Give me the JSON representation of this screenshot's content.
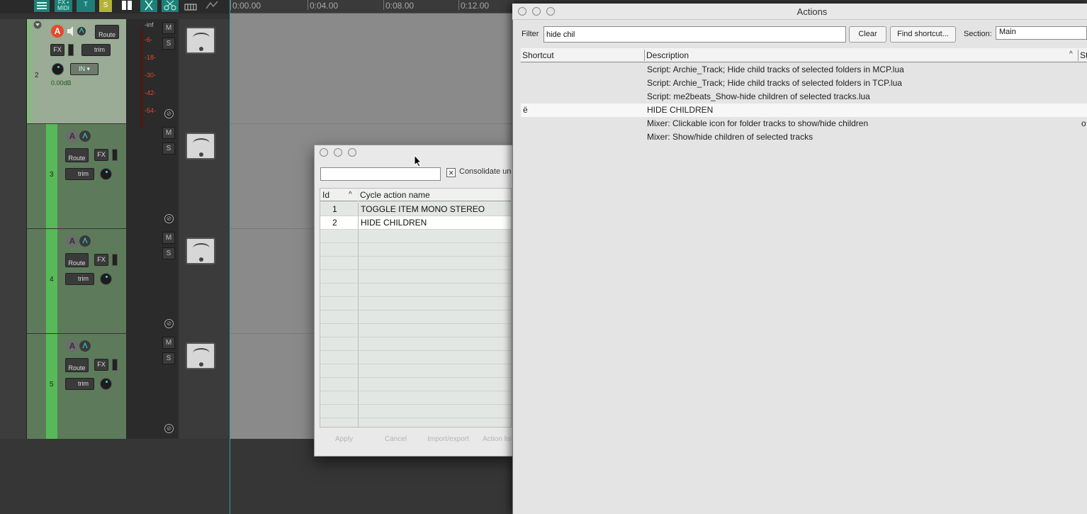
{
  "toolbar": {
    "buttons": [
      {
        "label": "",
        "icon": "grid-icon"
      },
      {
        "label": "FX • MIDI",
        "icon": ""
      },
      {
        "label": "T",
        "icon": ""
      },
      {
        "label": "S",
        "icon": ""
      },
      {
        "label": "",
        "icon": "split-icon"
      },
      {
        "label": "",
        "icon": "cut-icon"
      },
      {
        "label": "",
        "icon": "scissors-icon"
      },
      {
        "label": "",
        "icon": "snap-icon"
      },
      {
        "label": "",
        "icon": "envelope-icon"
      }
    ]
  },
  "ruler": {
    "ticks": [
      "0:00.00",
      "0:04.00",
      "0:08.00",
      "0:12.00"
    ]
  },
  "tracks": [
    {
      "number": "2",
      "volume": "0.00dB",
      "route": "Route",
      "fx": "FX",
      "trim": "trim",
      "input": "IN",
      "mute": "M",
      "solo": "S",
      "phase": "⊘",
      "folder": true
    },
    {
      "number": "3",
      "route": "Route",
      "fx": "FX",
      "trim": "trim",
      "mute": "M",
      "solo": "S",
      "phase": "⊘"
    },
    {
      "number": "4",
      "route": "Route",
      "fx": "FX",
      "trim": "trim",
      "mute": "M",
      "solo": "S",
      "phase": "⊘"
    },
    {
      "number": "5",
      "route": "Route",
      "fx": "FX",
      "trim": "trim",
      "mute": "M",
      "solo": "S",
      "phase": "⊘"
    }
  ],
  "meter": {
    "labels": [
      "-inf",
      "-6-",
      "-18-",
      "-30-",
      "-42-",
      "-54-"
    ]
  },
  "cycle_dialog": {
    "search_value": "",
    "consolidate_label": "Consolidate undo",
    "consolidate_checked": true,
    "columns": {
      "id": "Id",
      "name": "Cycle action name"
    },
    "rows": [
      {
        "id": "1",
        "name": "TOGGLE ITEM MONO STEREO"
      },
      {
        "id": "2",
        "name": "HIDE CHILDREN"
      }
    ],
    "buttons": {
      "apply": "Apply",
      "cancel": "Cancel",
      "import_export": "Import/export",
      "action_list": "Action list"
    }
  },
  "actions_window": {
    "title": "Actions",
    "filter_label": "Filter",
    "filter_value": "hide chil",
    "clear_label": "Clear",
    "find_shortcut_label": "Find shortcut...",
    "section_label": "Section:",
    "section_value": "Main",
    "columns": {
      "shortcut": "Shortcut",
      "description": "Description",
      "state": "St"
    },
    "rows": [
      {
        "shortcut": "",
        "description": "Script: Archie_Track;  Hide child tracks of selected folders in MCP.lua",
        "extra": ""
      },
      {
        "shortcut": "",
        "description": "Script: Archie_Track;  Hide child tracks of selected folders in TCP.lua",
        "extra": ""
      },
      {
        "shortcut": "",
        "description": "Script: me2beats_Show-hide children of selected tracks.lua",
        "extra": ""
      },
      {
        "shortcut": "ë",
        "description": "HIDE CHILDREN",
        "extra": ""
      },
      {
        "shortcut": "",
        "description": "Mixer: Clickable icon for folder tracks to show/hide children",
        "extra": "o"
      },
      {
        "shortcut": "",
        "description": "Mixer: Show/hide children of selected tracks",
        "extra": ""
      }
    ]
  }
}
